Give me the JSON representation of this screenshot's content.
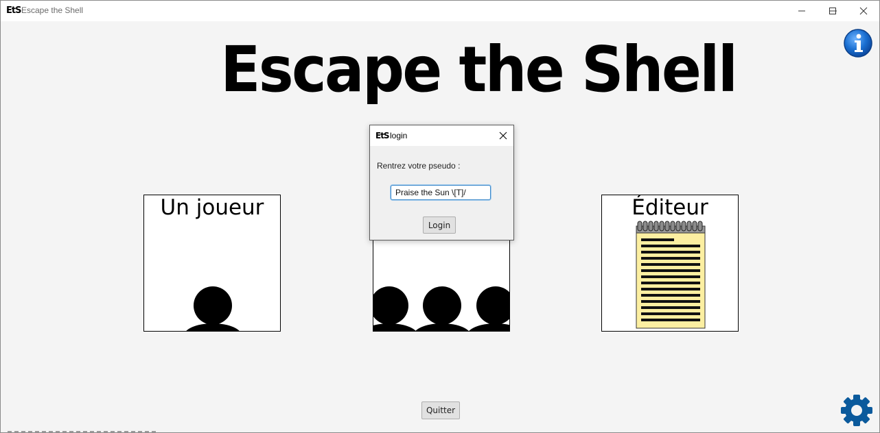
{
  "window": {
    "title": "Escape the Shell",
    "logo_text": "EtS"
  },
  "header": {
    "main_title": "Escape the Shell"
  },
  "cards": {
    "single_player": {
      "label": "Un joueur"
    },
    "multiplayer": {
      "label": ""
    },
    "editor": {
      "label": "Éditeur"
    }
  },
  "dialog": {
    "title": "login",
    "logo_text": "EtS",
    "prompt": "Rentrez votre pseudo :",
    "input_value": "Praise the Sun \\[T]/",
    "login_label": "Login"
  },
  "footer": {
    "quit_label": "Quitter"
  },
  "icons": {
    "info": "info-icon",
    "settings": "gear-icon",
    "minimize": "minimize-icon",
    "maximize": "maximize-icon",
    "close": "close-icon"
  },
  "colors": {
    "info_blue": "#1a6fd1",
    "gear_blue": "#0b5a9c",
    "notepad_yellow": "#fcefa1",
    "input_focus": "#3a87c9"
  }
}
